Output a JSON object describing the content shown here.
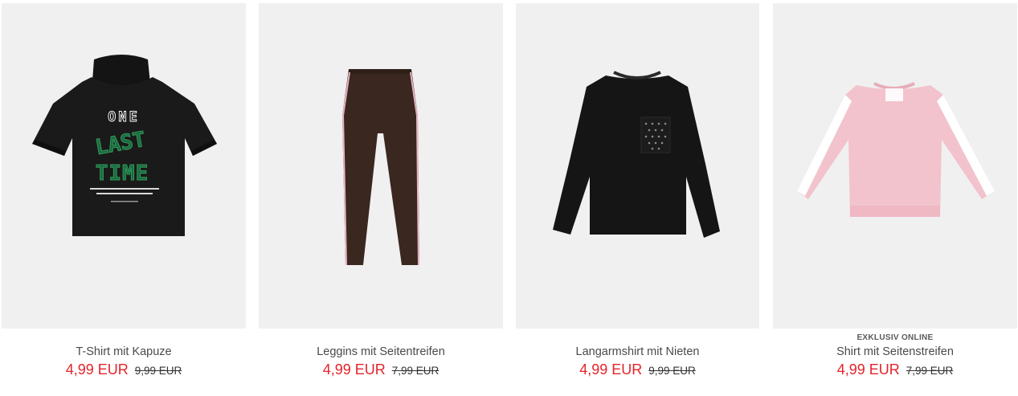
{
  "colors": {
    "sale_price": "#e3242b",
    "old_price": "#333333",
    "name": "#4a4a4a",
    "image_bg": "#f0f0f0"
  },
  "products": [
    {
      "image_icon": "hooded-tshirt-image",
      "print_text": [
        "ONE",
        "LAST",
        "TIME"
      ],
      "badge": "",
      "name": "T-Shirt mit Kapuze",
      "price": "4,99 EUR",
      "old_price": "9,99 EUR"
    },
    {
      "image_icon": "leggings-image",
      "badge": "",
      "name": "Leggins mit Seitentreifen",
      "price": "4,99 EUR",
      "old_price": "7,99 EUR"
    },
    {
      "image_icon": "longsleeve-shirt-image",
      "badge": "",
      "name": "Langarmshirt mit Nieten",
      "price": "4,99 EUR",
      "old_price": "9,99 EUR"
    },
    {
      "image_icon": "striped-sweatshirt-image",
      "badge": "EXKLUSIV ONLINE",
      "name": "Shirt mit Seitenstreifen",
      "price": "4,99 EUR",
      "old_price": "7,99 EUR"
    }
  ]
}
